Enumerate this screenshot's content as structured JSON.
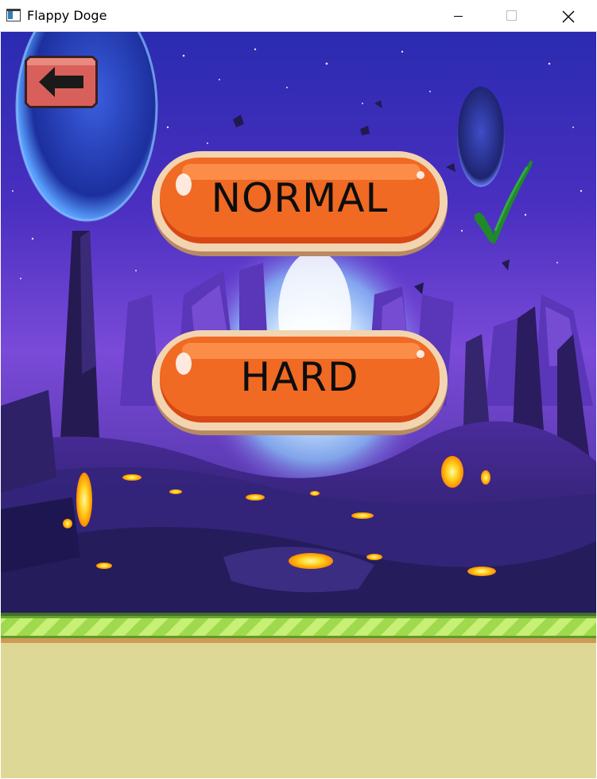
{
  "window": {
    "title": "Flappy Doge",
    "controls": {
      "minimize": "minimize-icon",
      "maximize": "maximize-icon",
      "close": "close-icon"
    }
  },
  "menu": {
    "back_icon": "arrow-left-icon",
    "normal_label": "NORMAL",
    "hard_label": "HARD",
    "selected_mode": "NORMAL",
    "selected_indicator_icon": "checkmark-icon"
  },
  "colors": {
    "button_fill": "#f06a23",
    "button_border": "#f3d4b0",
    "back_button_fill": "#d9605a",
    "checkmark": "#1e8a2a",
    "ground_grass": "#9fd94d",
    "ground_sand": "#ded896"
  }
}
